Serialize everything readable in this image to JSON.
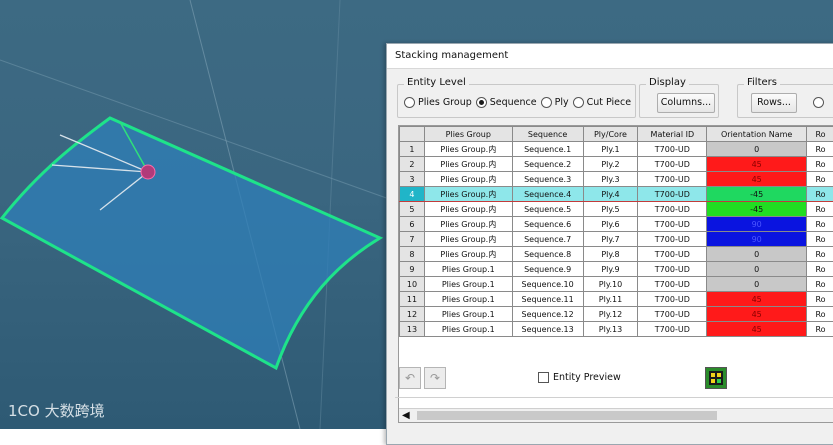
{
  "watermark": "1CO 大数跨境",
  "dialog": {
    "title": "Stacking management",
    "entity_level": {
      "legend": "Entity Level",
      "options": [
        "Plies Group",
        "Sequence",
        "Ply",
        "Cut Piece"
      ],
      "selected": "Sequence"
    },
    "display": {
      "legend": "Display",
      "button": "Columns..."
    },
    "filters": {
      "legend": "Filters",
      "button": "Rows..."
    },
    "table": {
      "headers": [
        "",
        "Plies Group",
        "Sequence",
        "Ply/Core",
        "Material ID",
        "Orientation Name",
        "Ro"
      ],
      "rows": [
        {
          "n": "1",
          "group": "Plies Group.内",
          "seq": "Sequence.1",
          "ply": "Ply.1",
          "mat": "T700-UD",
          "orient": "0",
          "color": "#c8c8c8",
          "ro": "Ro"
        },
        {
          "n": "2",
          "group": "Plies Group.内",
          "seq": "Sequence.2",
          "ply": "Ply.2",
          "mat": "T700-UD",
          "orient": "45",
          "color": "#ff1a1a",
          "ro": "Ro"
        },
        {
          "n": "3",
          "group": "Plies Group.内",
          "seq": "Sequence.3",
          "ply": "Ply.3",
          "mat": "T700-UD",
          "orient": "45",
          "color": "#ff1a1a",
          "ro": "Ro"
        },
        {
          "n": "4",
          "group": "Plies Group.内",
          "seq": "Sequence.4",
          "ply": "Ply.4",
          "mat": "T700-UD",
          "orient": "-45",
          "color": "#1fd860",
          "ro": "Ro",
          "selected": true
        },
        {
          "n": "5",
          "group": "Plies Group.内",
          "seq": "Sequence.5",
          "ply": "Ply.5",
          "mat": "T700-UD",
          "orient": "-45",
          "color": "#22dd22",
          "ro": "Ro"
        },
        {
          "n": "6",
          "group": "Plies Group.内",
          "seq": "Sequence.6",
          "ply": "Ply.6",
          "mat": "T700-UD",
          "orient": "90",
          "color": "#0a14e0",
          "ro": "Ro"
        },
        {
          "n": "7",
          "group": "Plies Group.内",
          "seq": "Sequence.7",
          "ply": "Ply.7",
          "mat": "T700-UD",
          "orient": "90",
          "color": "#0a14e0",
          "ro": "Ro"
        },
        {
          "n": "8",
          "group": "Plies Group.内",
          "seq": "Sequence.8",
          "ply": "Ply.8",
          "mat": "T700-UD",
          "orient": "0",
          "color": "#c8c8c8",
          "ro": "Ro"
        },
        {
          "n": "9",
          "group": "Plies Group.1",
          "seq": "Sequence.9",
          "ply": "Ply.9",
          "mat": "T700-UD",
          "orient": "0",
          "color": "#c8c8c8",
          "ro": "Ro"
        },
        {
          "n": "10",
          "group": "Plies Group.1",
          "seq": "Sequence.10",
          "ply": "Ply.10",
          "mat": "T700-UD",
          "orient": "0",
          "color": "#c8c8c8",
          "ro": "Ro"
        },
        {
          "n": "11",
          "group": "Plies Group.1",
          "seq": "Sequence.11",
          "ply": "Ply.11",
          "mat": "T700-UD",
          "orient": "45",
          "color": "#ff1a1a",
          "ro": "Ro"
        },
        {
          "n": "12",
          "group": "Plies Group.1",
          "seq": "Sequence.12",
          "ply": "Ply.12",
          "mat": "T700-UD",
          "orient": "45",
          "color": "#ff1a1a",
          "ro": "Ro"
        },
        {
          "n": "13",
          "group": "Plies Group.1",
          "seq": "Sequence.13",
          "ply": "Ply.13",
          "mat": "T700-UD",
          "orient": "45",
          "color": "#ff1a1a",
          "ro": "Ro"
        }
      ]
    },
    "entity_preview": "Entity Preview",
    "icons": {
      "undo": "undo-icon",
      "redo": "redo-icon",
      "grid": "grid-icon"
    }
  }
}
